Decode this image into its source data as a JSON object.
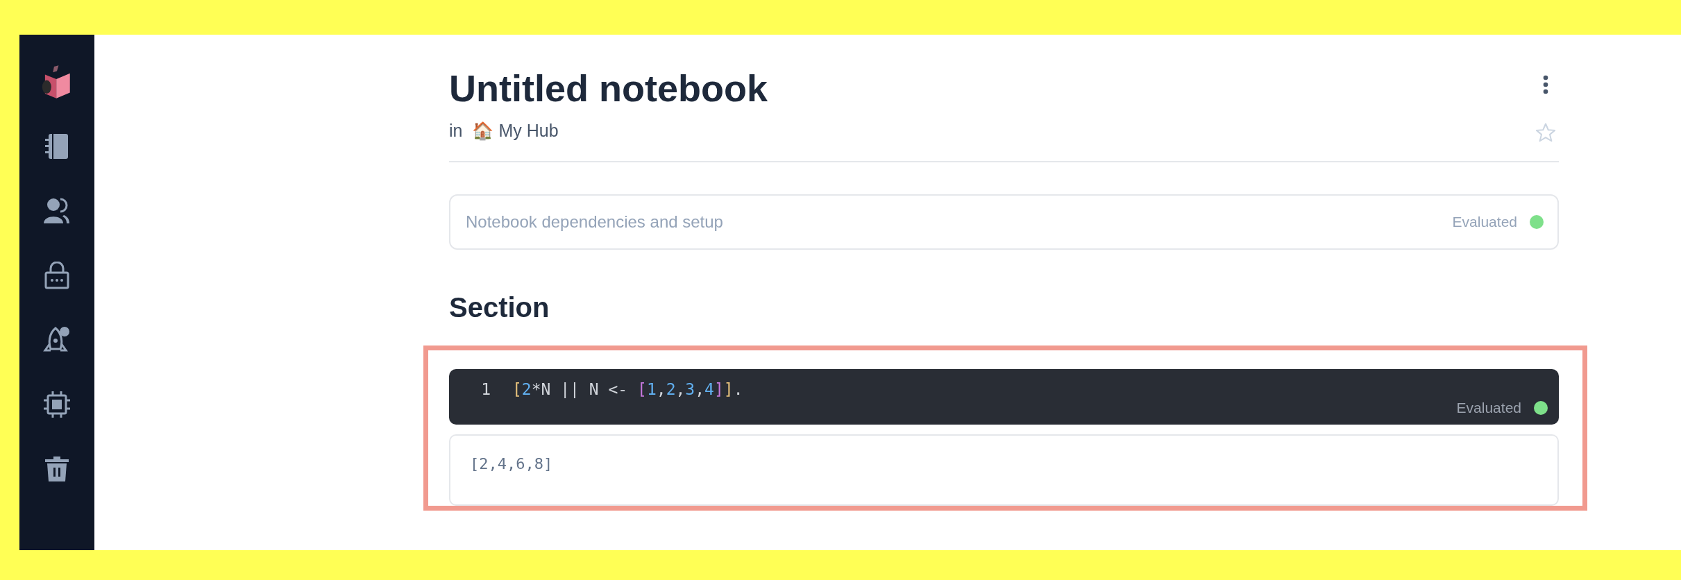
{
  "sidebar": {
    "items": [
      {
        "kind": "logo"
      },
      {
        "kind": "notebooks"
      },
      {
        "kind": "people"
      },
      {
        "kind": "secrets"
      },
      {
        "kind": "launch"
      },
      {
        "kind": "compute"
      },
      {
        "kind": "trash"
      }
    ]
  },
  "notebook": {
    "title": "Untitled notebook",
    "location_prefix": "in",
    "location_emoji": "🏠",
    "location": "My Hub",
    "starred": false
  },
  "setup_cell": {
    "label": "Notebook dependencies and setup",
    "status": "Evaluated"
  },
  "section": {
    "heading": "Section"
  },
  "code_cell": {
    "line_number": "1",
    "tokens": [
      {
        "text": "[",
        "color": "#e5c07b"
      },
      {
        "text": "2",
        "color": "#61afef"
      },
      {
        "text": "*N || N <- ",
        "color": "#d1d5db"
      },
      {
        "text": "[",
        "color": "#c678dd"
      },
      {
        "text": "1",
        "color": "#61afef"
      },
      {
        "text": ",",
        "color": "#d1d5db"
      },
      {
        "text": "2",
        "color": "#61afef"
      },
      {
        "text": ",",
        "color": "#d1d5db"
      },
      {
        "text": "3",
        "color": "#61afef"
      },
      {
        "text": ",",
        "color": "#d1d5db"
      },
      {
        "text": "4",
        "color": "#61afef"
      },
      {
        "text": "]",
        "color": "#c678dd"
      },
      {
        "text": "]",
        "color": "#e5c07b"
      },
      {
        "text": ".",
        "color": "#d1d5db"
      }
    ],
    "status": "Evaluated",
    "output": "[2,4,6,8]"
  }
}
